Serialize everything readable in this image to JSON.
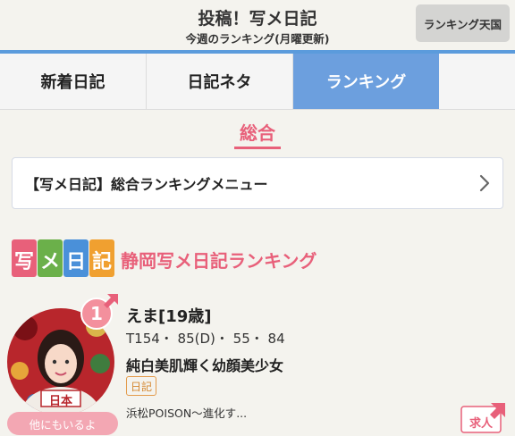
{
  "header": {
    "title": "投稿！写メ日記",
    "subtitle": "今週のランキング(月曜更新)",
    "ranking_heaven_button": "ランキング天国"
  },
  "tabs": [
    {
      "label": "新着日記",
      "active": false
    },
    {
      "label": "日記ネタ",
      "active": false
    },
    {
      "label": "ランキング",
      "active": true
    }
  ],
  "section": {
    "title": "総合"
  },
  "menu_bar": {
    "label": "【写メ日記】総合ランキングメニュー"
  },
  "ranking": {
    "logo_glyphs": [
      "写",
      "メ",
      "日",
      "記"
    ],
    "title": "静岡写メ日記ランキング",
    "entries": [
      {
        "rank": "1",
        "name": "えま[19歳]",
        "stats": "T154・ 85(D)・ 55・ 84",
        "catchphrase": "純白美肌輝く幼顔美少女",
        "tag": "日記",
        "shop": "浜松POISON～進化す...",
        "others_button": "他にもいるよ",
        "avatar_banner": "日本"
      }
    ]
  },
  "kyujin": {
    "label": "求人"
  },
  "colors": {
    "accent_pink": "#e8607a",
    "active_tab": "#6c9fde",
    "tab_border": "#5b9bdc",
    "background": "#f4f3ee",
    "logo_tiles": [
      "#e8607a",
      "#6bb04a",
      "#4a90d9",
      "#f0a030"
    ]
  }
}
